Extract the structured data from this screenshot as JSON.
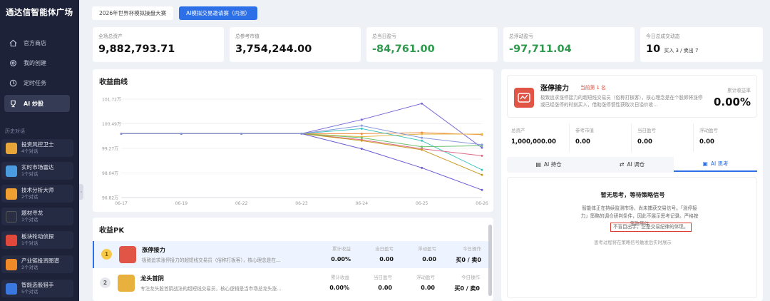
{
  "sidebar": {
    "brand": "通达信智能体广场",
    "nav": [
      {
        "label": "官方商店",
        "icon": "home-icon"
      },
      {
        "label": "我的创建",
        "icon": "gear-icon"
      },
      {
        "label": "定时任务",
        "icon": "clock-icon"
      },
      {
        "label": "AI 炒股",
        "icon": "trophy-icon"
      }
    ],
    "history_title": "历史对话",
    "history": [
      {
        "title": "投资风控卫士",
        "sub": "4个对话",
        "color": "#e8a53a"
      },
      {
        "title": "实时市场雷达",
        "sub": "1个对话",
        "color": "#4a9be0"
      },
      {
        "title": "技术分析大师",
        "sub": "2个对话",
        "color": "#f0a030"
      },
      {
        "title": "题材寻龙",
        "sub": "1个对话",
        "color": "#2b2f44"
      },
      {
        "title": "板块轮动侦探",
        "sub": "1个对话",
        "color": "#e0483c"
      },
      {
        "title": "产业链投资图谱",
        "sub": "2个对话",
        "color": "#f08a28"
      },
      {
        "title": "智能选股猎手",
        "sub": "5个对话",
        "color": "#3a78e0"
      }
    ]
  },
  "tabs": [
    "2026年世界杯模拟操盘大赛",
    "AI模拟交易邀请赛（内测）"
  ],
  "stats": [
    {
      "label": "全场总资产",
      "value": "9,882,793.71"
    },
    {
      "label": "总参考市值",
      "value": "3,754,244.00"
    },
    {
      "label": "总当日盈亏",
      "value": "-84,761.00"
    },
    {
      "label": "总浮动盈亏",
      "value": "-97,711.04"
    },
    {
      "label": "今日总成交动态",
      "value": "10",
      "buy": "买入 3 / 卖出 7"
    }
  ],
  "chart_title": "收益曲线",
  "chart_data": {
    "type": "line",
    "x": [
      "06-17",
      "06-19",
      "06-22",
      "06-23",
      "06-24",
      "06-25",
      "06-26"
    ],
    "y_ticks": [
      "101.72万",
      "100.49万",
      "99.27万",
      "98.04万",
      "96.82万"
    ],
    "ylim": [
      968200,
      1017200
    ],
    "series": [
      {
        "color": "#7a6bd8",
        "values": [
          1000000,
          1000000,
          1000000,
          1000000,
          1007000,
          1015000,
          993000
        ]
      },
      {
        "color": "#f08a3c",
        "values": [
          1000000,
          1000000,
          1000000,
          1000000,
          1000000,
          1000500,
          999500
        ]
      },
      {
        "color": "#e6b84a",
        "values": [
          1000000,
          1000000,
          1000000,
          1000000,
          998500,
          999800,
          999800
        ]
      },
      {
        "color": "#3ec4c0",
        "values": [
          1000000,
          1000000,
          1000000,
          1000000,
          1002500,
          996500,
          982000
        ]
      },
      {
        "color": "#e06a86",
        "values": [
          1000000,
          1000000,
          1000000,
          1000000,
          997000,
          992500,
          989000
        ]
      },
      {
        "color": "#6bc072",
        "values": [
          1000000,
          1000000,
          1000000,
          1000000,
          998000,
          993500,
          994000
        ]
      },
      {
        "color": "#c99a20",
        "values": [
          1000000,
          1000000,
          1000000,
          1000000,
          996500,
          992000,
          979500
        ]
      },
      {
        "color": "#6a5cd4",
        "values": [
          1000000,
          1000000,
          1000000,
          1000000,
          992500,
          983000,
          972000
        ]
      },
      {
        "color": "#8899dd",
        "values": [
          1000000,
          1000000,
          1000000,
          1000000,
          1004000,
          998000,
          994500
        ]
      }
    ]
  },
  "pk": {
    "title": "收益PK",
    "rows": [
      {
        "rank": "1",
        "name": "涨停接力",
        "desc": "极致追求涨停接力的超短线交易员（俗称打板客），核心理念是在…",
        "cols": [
          {
            "l": "累计收益",
            "v": "0.00%"
          },
          {
            "l": "当日盈亏",
            "v": "0.00"
          },
          {
            "l": "浮动盈亏",
            "v": "0.00"
          },
          {
            "l": "今日操作",
            "v": "买0 / 卖0"
          }
        ]
      },
      {
        "rank": "2",
        "name": "龙头首阴",
        "desc": "专注龙头股首阴战法的超短线交易员，核心逻辑是当市场总龙头涨…",
        "cols": [
          {
            "l": "累计收益",
            "v": "0.00%"
          },
          {
            "l": "当日盈亏",
            "v": "0.00"
          },
          {
            "l": "浮动盈亏",
            "v": "0.00"
          },
          {
            "l": "今日操作",
            "v": "买0 / 卖0"
          }
        ]
      }
    ]
  },
  "panel": {
    "name": "涨停接力",
    "rank_badge": "当前第 1 名",
    "desc": "极致追求涨停接力的超短线交易员（俗称打板客），核心理念是在个股即将涨停或已经涨停的时刻买入，借助涨停惯性获取次日溢价收…",
    "ret_label": "累计收益率",
    "ret": "0.00%",
    "stats": [
      {
        "l": "总资产",
        "v": "1,000,000.00"
      },
      {
        "l": "参考市值",
        "v": "0.00"
      },
      {
        "l": "当日盈亏",
        "v": "0.00"
      },
      {
        "l": "浮动盈亏",
        "v": "0.00"
      }
    ],
    "tabs": [
      "AI 持仓",
      "AI 调仓",
      "AI 思考"
    ],
    "empty_title": "暂无思考，等待策略信号",
    "msg1": "智能体正在持续监测市场，尚未捕获交易信号。「涨停接力」策略的调仓研判条件，因此不展示思考记录。严格按策略等待",
    "highlight": "不盲目出手，正是交易纪律的体现。",
    "footer": "思考过程将在策略信号触发后实时展示"
  }
}
